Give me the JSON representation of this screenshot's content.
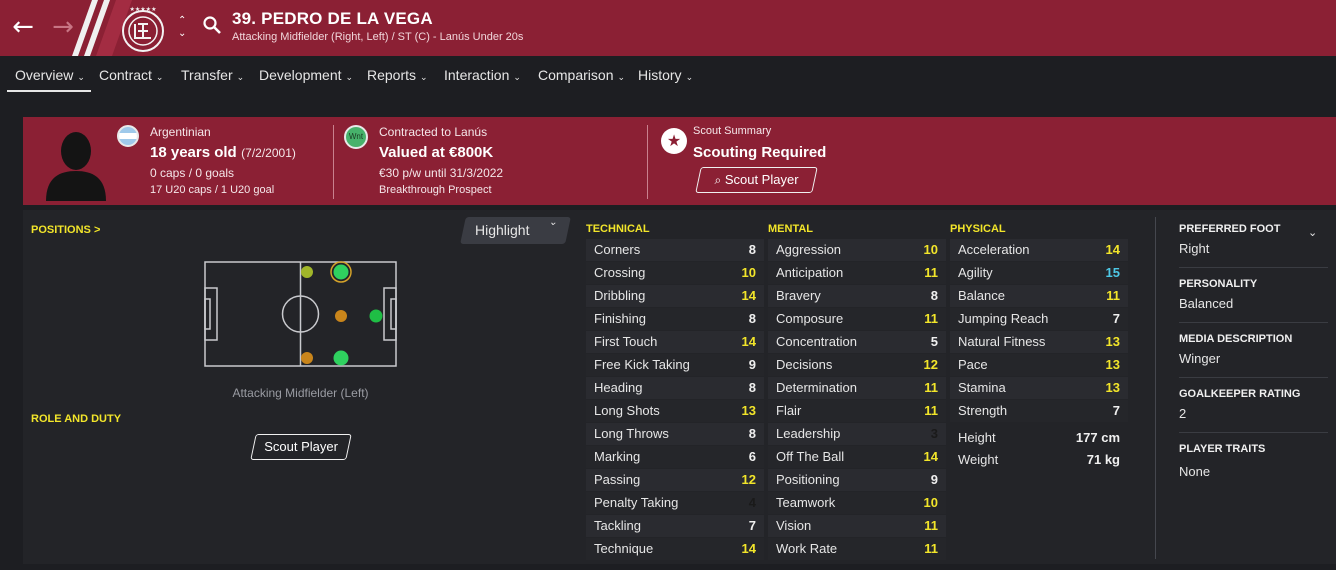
{
  "header": {
    "player_title": "39. PEDRO DE LA VEGA",
    "subtitle": "Attacking Midfielder (Right, Left) / ST (C) - Lanús Under 20s",
    "back_icon": "arrow-left-icon",
    "forward_icon": "arrow-right-icon",
    "colors": {
      "header_bg": "#8b2034"
    }
  },
  "tabs": [
    {
      "label": "Overview",
      "chevron": "⌄",
      "active": true
    },
    {
      "label": "Contract",
      "chevron": "⌄"
    },
    {
      "label": "Transfer",
      "chevron": "⌄"
    },
    {
      "label": "Development",
      "chevron": "⌄"
    },
    {
      "label": "Reports",
      "chevron": "⌄"
    },
    {
      "label": "Interaction",
      "chevron": "⌄"
    },
    {
      "label": "Comparison",
      "chevron": "⌄"
    },
    {
      "label": "History",
      "chevron": "⌄"
    }
  ],
  "banner": {
    "nationality": "Argentinian",
    "age": "18 years old",
    "dob": "(7/2/2001)",
    "caps": "0 caps / 0 goals",
    "u20_caps": "17 U20 caps / 1 U20 goal",
    "contract_label": "Contracted to Lanús",
    "status_badge": "Wnt",
    "value": "Valued at €800K",
    "wage": "€30 p/w until 31/3/2022",
    "prospect": "Breakthrough Prospect",
    "scout_summary_label": "Scout Summary",
    "scout_status": "Scouting Required",
    "scout_button": "Scout Player"
  },
  "positions": {
    "section_label": "POSITIONS >",
    "highlight_label": "Highlight",
    "caption": "Attacking Midfielder (Left)",
    "role_label": "ROLE AND DUTY",
    "scout_button": "Scout Player"
  },
  "attributes": {
    "technical": {
      "label": "TECHNICAL",
      "items": [
        {
          "name": "Corners",
          "value": "8",
          "tone": "w"
        },
        {
          "name": "Crossing",
          "value": "10",
          "tone": "y"
        },
        {
          "name": "Dribbling",
          "value": "14",
          "tone": "y"
        },
        {
          "name": "Finishing",
          "value": "8",
          "tone": "w"
        },
        {
          "name": "First Touch",
          "value": "14",
          "tone": "y"
        },
        {
          "name": "Free Kick Taking",
          "value": "9",
          "tone": "w"
        },
        {
          "name": "Heading",
          "value": "8",
          "tone": "w"
        },
        {
          "name": "Long Shots",
          "value": "13",
          "tone": "y"
        },
        {
          "name": "Long Throws",
          "value": "8",
          "tone": "w"
        },
        {
          "name": "Marking",
          "value": "6",
          "tone": "w"
        },
        {
          "name": "Passing",
          "value": "12",
          "tone": "y"
        },
        {
          "name": "Penalty Taking",
          "value": "4",
          "tone": "d"
        },
        {
          "name": "Tackling",
          "value": "7",
          "tone": "w"
        },
        {
          "name": "Technique",
          "value": "14",
          "tone": "y"
        }
      ]
    },
    "mental": {
      "label": "MENTAL",
      "items": [
        {
          "name": "Aggression",
          "value": "10",
          "tone": "y"
        },
        {
          "name": "Anticipation",
          "value": "11",
          "tone": "y"
        },
        {
          "name": "Bravery",
          "value": "8",
          "tone": "w"
        },
        {
          "name": "Composure",
          "value": "11",
          "tone": "y"
        },
        {
          "name": "Concentration",
          "value": "5",
          "tone": "w"
        },
        {
          "name": "Decisions",
          "value": "12",
          "tone": "y"
        },
        {
          "name": "Determination",
          "value": "11",
          "tone": "y"
        },
        {
          "name": "Flair",
          "value": "11",
          "tone": "y"
        },
        {
          "name": "Leadership",
          "value": "3",
          "tone": "d"
        },
        {
          "name": "Off The Ball",
          "value": "14",
          "tone": "y"
        },
        {
          "name": "Positioning",
          "value": "9",
          "tone": "w"
        },
        {
          "name": "Teamwork",
          "value": "10",
          "tone": "y"
        },
        {
          "name": "Vision",
          "value": "11",
          "tone": "y"
        },
        {
          "name": "Work Rate",
          "value": "11",
          "tone": "y"
        }
      ]
    },
    "physical": {
      "label": "PHYSICAL",
      "items": [
        {
          "name": "Acceleration",
          "value": "14",
          "tone": "y"
        },
        {
          "name": "Agility",
          "value": "15",
          "tone": "c"
        },
        {
          "name": "Balance",
          "value": "11",
          "tone": "y"
        },
        {
          "name": "Jumping Reach",
          "value": "7",
          "tone": "w"
        },
        {
          "name": "Natural Fitness",
          "value": "13",
          "tone": "y"
        },
        {
          "name": "Pace",
          "value": "13",
          "tone": "y"
        },
        {
          "name": "Stamina",
          "value": "13",
          "tone": "y"
        },
        {
          "name": "Strength",
          "value": "7",
          "tone": "w"
        }
      ],
      "height_label": "Height",
      "height_value": "177 cm",
      "weight_label": "Weight",
      "weight_value": "71 kg"
    }
  },
  "info": {
    "preferred_foot_label": "PREFERRED FOOT",
    "preferred_foot": "Right",
    "personality_label": "PERSONALITY",
    "personality": "Balanced",
    "media_label": "MEDIA DESCRIPTION",
    "media": "Winger",
    "gk_label": "GOALKEEPER RATING",
    "gk": "2",
    "traits_label": "PLAYER TRAITS",
    "traits": "None"
  }
}
